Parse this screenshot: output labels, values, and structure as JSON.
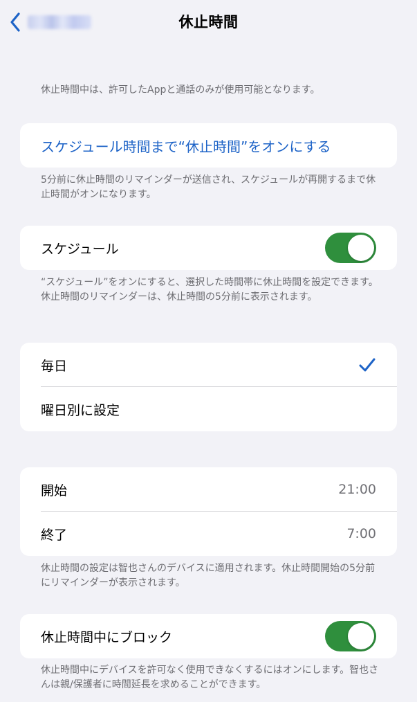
{
  "nav": {
    "title": "休止時間"
  },
  "intro": "休止時間中は、許可したAppと通話のみが使用可能となります。",
  "schedule_now": {
    "label": "スケジュール時間まで“休止時間”をオンにする",
    "footnote": "5分前に休止時間のリマインダーが送信され、スケジュールが再開するまで休止時間がオンになります。"
  },
  "schedule": {
    "label": "スケジュール",
    "toggle_on": true,
    "footnote": "“スケジュール”をオンにすると、選択した時間帯に休止時間を設定できます。休止時間のリマインダーは、休止時間の5分前に表示されます。"
  },
  "days": {
    "every_day": "毎日",
    "every_day_selected": true,
    "custom": "曜日別に設定"
  },
  "times": {
    "start_label": "開始",
    "start_value": "21:00",
    "end_label": "終了",
    "end_value": "7:00",
    "footnote": "休止時間の設定は智也さんのデバイスに適用されます。休止時間開始の5分前にリマインダーが表示されます。"
  },
  "block": {
    "label": "休止時間中にブロック",
    "toggle_on": true,
    "footnote": "休止時間中にデバイスを許可なく使用できなくするにはオンにします。智也さんは親/保護者に時間延長を求めることができます。"
  },
  "colors": {
    "accent": "#1d63c7",
    "toggle_on": "#2f8f3d",
    "background": "#f2f2f7",
    "secondary_text": "#6d6d72"
  }
}
